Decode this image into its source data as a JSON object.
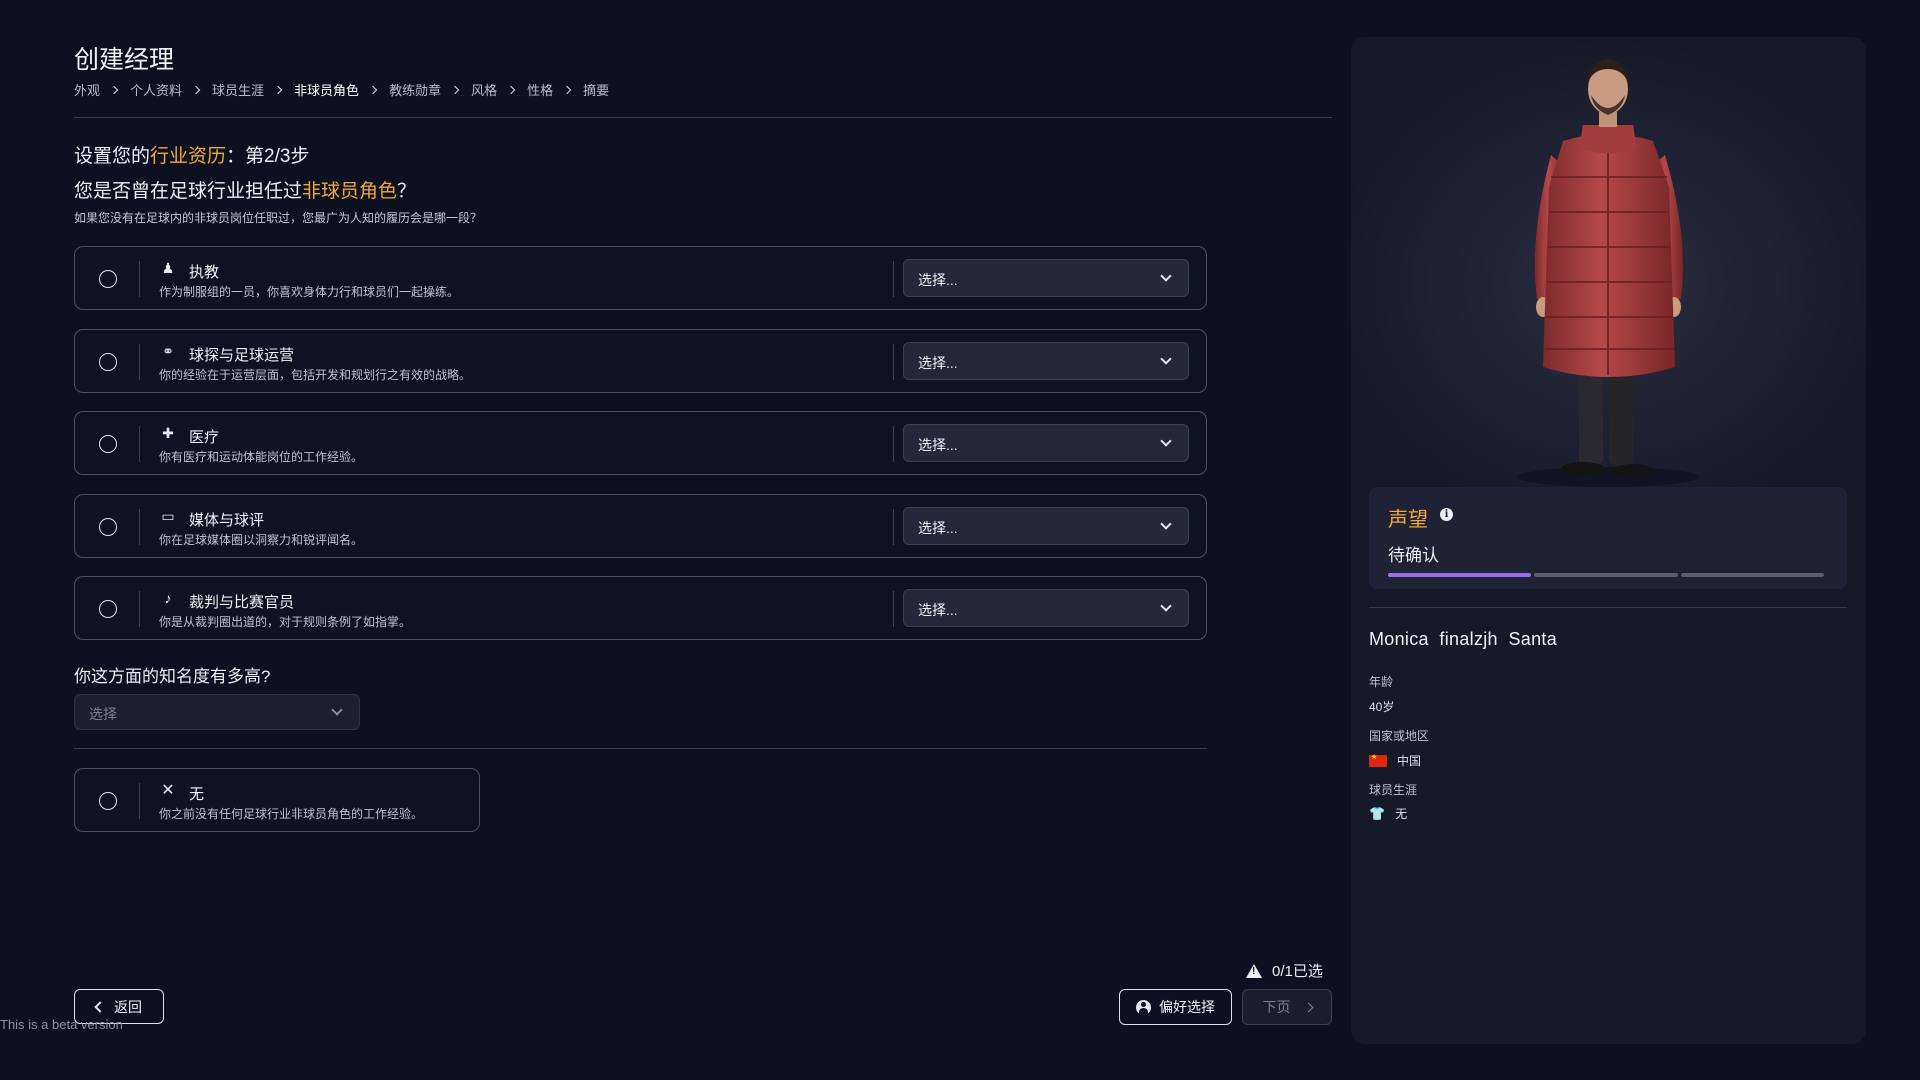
{
  "header": {
    "title": "创建经理",
    "breadcrumb": [
      "外观",
      "个人资料",
      "球员生涯",
      "非球员角色",
      "教练勋章",
      "风格",
      "性格",
      "摘要"
    ],
    "active_crumb": "非球员角色"
  },
  "question": {
    "step_prefix": "设置您的",
    "step_highlight": "行业资历",
    "step_suffix": "：第2/3步",
    "main_prefix": "您是否曾在足球行业担任过",
    "main_highlight": "非球员角色",
    "main_suffix": "？",
    "hint": "如果您没有在足球内的非球员岗位任职过，您最广为人知的履历会是哪一段？"
  },
  "options": [
    {
      "icon": "coaching-icon",
      "glyph": "♟",
      "title": "执教",
      "desc": "作为制服组的一员，你喜欢身体力行和球员们一起操练。",
      "select": "选择..."
    },
    {
      "icon": "binoculars-icon",
      "glyph": "⚭",
      "title": "球探与足球运营",
      "desc": "你的经验在于运营层面，包括开发和规划行之有效的战略。",
      "select": "选择..."
    },
    {
      "icon": "medical-kit-icon",
      "glyph": "✚",
      "title": "医疗",
      "desc": "你有医疗和运动体能岗位的工作经验。",
      "select": "选择..."
    },
    {
      "icon": "monitor-icon",
      "glyph": "▭",
      "title": "媒体与球评",
      "desc": "你在足球媒体圈以洞察力和锐评闻名。",
      "select": "选择..."
    },
    {
      "icon": "referee-whistle-icon",
      "glyph": "♪",
      "title": "裁判与比赛官员",
      "desc": "你是从裁判圈出道的，对于规则条例了如指掌。",
      "select": "选择..."
    }
  ],
  "fame": {
    "label": "你这方面的知名度有多高?",
    "placeholder": "选择"
  },
  "none_option": {
    "glyph": "✕",
    "title": "无",
    "desc": "你之前没有任何足球行业非球员角色的工作经验。"
  },
  "footer": {
    "back_label": "返回",
    "beta": "This is a beta version",
    "selected_count": "0/1已选",
    "preference_label": "偏好选择",
    "next_label": "下页"
  },
  "profile": {
    "reputation_title": "声望",
    "reputation_status": "待确认",
    "reputation_level": 1,
    "reputation_total": 3,
    "name": "Monica  finalzjh  Santa",
    "age_label": "年龄",
    "age_value": "40岁",
    "nation_label": "国家或地区",
    "nation_value": "中国",
    "career_label": "球员生涯",
    "career_value": "无"
  },
  "colors": {
    "accent": "#f1a83a",
    "background": "#0d1020",
    "panel": "#161928",
    "progress": "#9a6ee8"
  }
}
